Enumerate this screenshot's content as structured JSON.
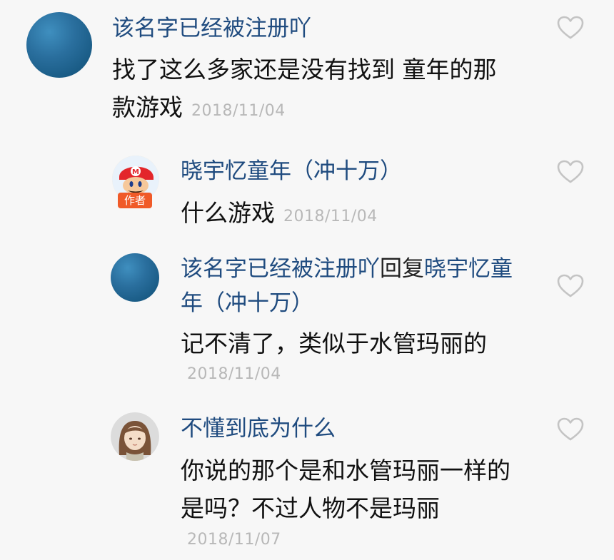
{
  "comments": [
    {
      "username": "该名字已经被注册吖",
      "text_line1": "找了这么多家还是没有找到 童年的那",
      "text_line2": "款游戏",
      "date": "2018/11/04"
    },
    {
      "username": "晓宇忆童年（冲十万）",
      "badge": "作者",
      "text": "什么游戏",
      "date": "2018/11/04"
    },
    {
      "username": "该名字已经被注册吖",
      "reply_word": "回复",
      "reply_target_line1": "晓宇忆童",
      "reply_target_line2": "年（冲十万）",
      "text": "记不清了，类似于水管玛丽的",
      "date": "2018/11/04"
    },
    {
      "username": "不懂到底为什么",
      "text_line1": "你说的那个是和水管玛丽一样的",
      "text_line2": "是吗？不过人物不是玛丽",
      "date": "2018/11/07"
    }
  ],
  "icons": {
    "like": "heart-outline-icon",
    "author_avatar": "mario-icon",
    "girl_avatar": "girl-cartoon-icon"
  },
  "colors": {
    "username": "#1f4b7f",
    "date": "#b8b8b8",
    "badge": "#f05a28",
    "background": "#f7f7f7"
  }
}
